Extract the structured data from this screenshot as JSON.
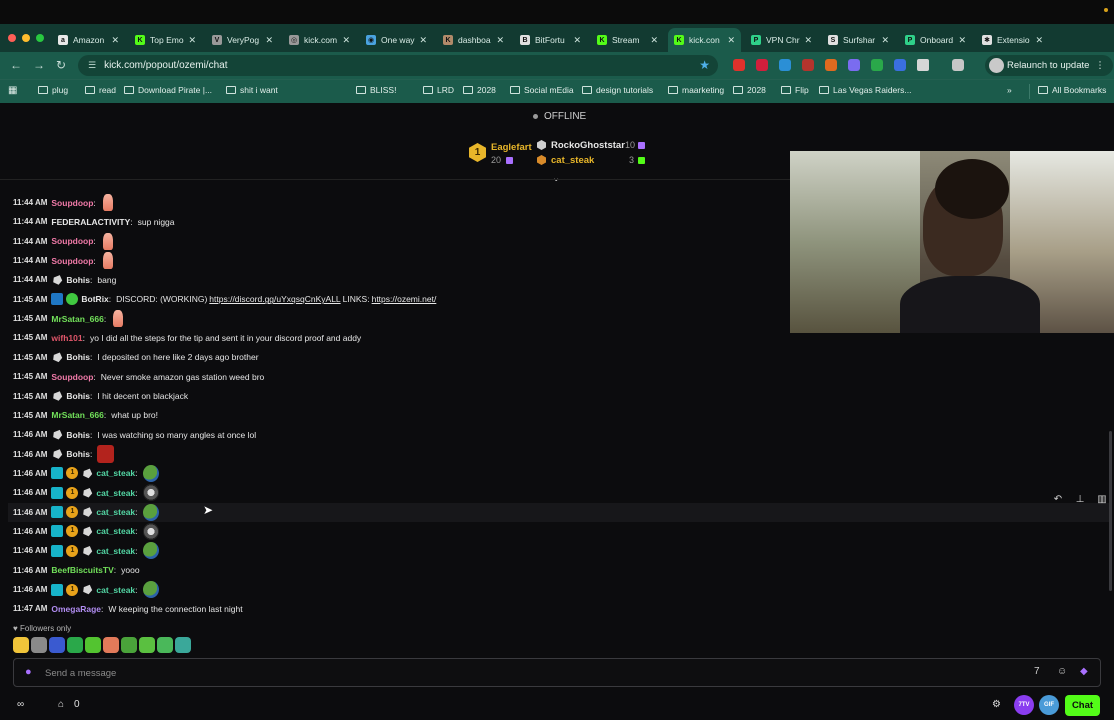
{
  "browser": {
    "tabs": [
      {
        "label": "Amazon",
        "fav": "a",
        "color": "#e8e8e8",
        "fg": "#111"
      },
      {
        "label": "Top Emo",
        "fav": "K",
        "color": "#53fc18",
        "fg": "#111"
      },
      {
        "label": "VeryPog",
        "fav": "V",
        "color": "#999",
        "fg": "#111"
      },
      {
        "label": "kick.com",
        "fav": "◎",
        "color": "#999",
        "fg": "#111"
      },
      {
        "label": "One way",
        "fav": "◉",
        "color": "#4aa3e0",
        "fg": "#111"
      },
      {
        "label": "dashboa",
        "fav": "K",
        "color": "#b18a6a",
        "fg": "#111"
      },
      {
        "label": "BitFortu",
        "fav": "B",
        "color": "#e0e0e0",
        "fg": "#111"
      },
      {
        "label": "Stream",
        "fav": "K",
        "color": "#53fc18",
        "fg": "#111"
      },
      {
        "label": "kick.con",
        "fav": "K",
        "color": "#53fc18",
        "fg": "#111"
      },
      {
        "label": "VPN Chr",
        "fav": "P",
        "color": "#2fd18a",
        "fg": "#111"
      },
      {
        "label": "Surfshar",
        "fav": "S",
        "color": "#e0e0e0",
        "fg": "#111"
      },
      {
        "label": "Onboard",
        "fav": "P",
        "color": "#2fd18a",
        "fg": "#111"
      },
      {
        "label": "Extensio",
        "fav": "✱",
        "color": "#e0e0e0",
        "fg": "#111"
      }
    ],
    "url": "kick.com/popout/ozemi/chat",
    "relaunch_label": "Relaunch to update",
    "bookmarks": [
      "plug",
      "read",
      "Download Pirate |...",
      "shit i want",
      "BLISS!",
      "LRD",
      "2028",
      "Social mEdia",
      "design tutorials",
      "maarketing",
      "2028",
      "Flip",
      "Las Vegas Raiders..."
    ],
    "all_bookmarks_label": "All Bookmarks"
  },
  "stream": {
    "status": "OFFLINE",
    "leaderboard": [
      {
        "rank": "1",
        "name": "Eaglefart",
        "count": "20"
      },
      {
        "name": "RockoGhoststar",
        "count": "10"
      },
      {
        "name": "cat_steak",
        "count": "3"
      }
    ]
  },
  "chat": {
    "messages": [
      {
        "time": "11:44 AM",
        "user": "Soupdoop",
        "user_color": "#f07aa8",
        "text": "",
        "emote": "hand"
      },
      {
        "time": "11:44 AM",
        "user": "FEDERALACTIVITY",
        "user_color": "#e6e6e6",
        "text": "sup nigga"
      },
      {
        "time": "11:44 AM",
        "user": "Soupdoop",
        "user_color": "#f07aa8",
        "text": "",
        "emote": "hand"
      },
      {
        "time": "11:44 AM",
        "user": "Soupdoop",
        "user_color": "#f07aa8",
        "text": "",
        "emote": "hand"
      },
      {
        "time": "11:44 AM",
        "user": "Bohis",
        "user_color": "#e6e6e6",
        "badges": [
          "og"
        ],
        "text": "bang"
      },
      {
        "time": "11:45 AM",
        "user": "BotRix",
        "user_color": "#e6e6e6",
        "badges": [
          "bot",
          "verified"
        ],
        "text": "DISCORD: (WORKING)",
        "link1": "https://discord.gg/uYxqsqCnKyALL",
        "text2": "LINKS:",
        "link2": "https://ozemi.net/"
      },
      {
        "time": "11:45 AM",
        "user": "MrSatan_666",
        "user_color": "#72e05a",
        "text": "",
        "emote": "hand"
      },
      {
        "time": "11:45 AM",
        "user": "wifh101",
        "user_color": "#e0566a",
        "text": "yo I did all the steps for the tip and sent it in your discord proof and addy"
      },
      {
        "time": "11:45 AM",
        "user": "Bohis",
        "user_color": "#e6e6e6",
        "badges": [
          "og"
        ],
        "text": "I deposited on here like 2 days ago brother"
      },
      {
        "time": "11:45 AM",
        "user": "Soupdoop",
        "user_color": "#f07aa8",
        "text": "Never smoke amazon gas station weed bro"
      },
      {
        "time": "11:45 AM",
        "user": "Bohis",
        "user_color": "#e6e6e6",
        "badges": [
          "og"
        ],
        "text": "I hit decent on blackjack"
      },
      {
        "time": "11:45 AM",
        "user": "MrSatan_666",
        "user_color": "#72e05a",
        "text": "what up bro!"
      },
      {
        "time": "11:46 AM",
        "user": "Bohis",
        "user_color": "#e6e6e6",
        "badges": [
          "og"
        ],
        "text": "I was watching so many angles at once lol"
      },
      {
        "time": "11:46 AM",
        "user": "Bohis",
        "user_color": "#e6e6e6",
        "badges": [
          "og"
        ],
        "text": "",
        "emote": "rage"
      },
      {
        "time": "11:46 AM",
        "user": "cat_steak",
        "user_color": "#53d6a4",
        "badges": [
          "sub",
          "vip",
          "og"
        ],
        "text": "",
        "emote": "pepe"
      },
      {
        "time": "11:46 AM",
        "user": "cat_steak",
        "user_color": "#53d6a4",
        "badges": [
          "sub",
          "vip",
          "og"
        ],
        "text": "",
        "emote": "sad"
      },
      {
        "time": "11:46 AM",
        "user": "cat_steak",
        "user_color": "#53d6a4",
        "badges": [
          "sub",
          "vip",
          "og"
        ],
        "text": "",
        "emote": "pepe",
        "highlight": true
      },
      {
        "time": "11:46 AM",
        "user": "cat_steak",
        "user_color": "#53d6a4",
        "badges": [
          "sub",
          "vip",
          "og"
        ],
        "text": "",
        "emote": "sad"
      },
      {
        "time": "11:46 AM",
        "user": "cat_steak",
        "user_color": "#53d6a4",
        "badges": [
          "sub",
          "vip",
          "og"
        ],
        "text": "",
        "emote": "pepe"
      },
      {
        "time": "11:46 AM",
        "user": "BeefBiscuitsTV",
        "user_color": "#72e05a",
        "text": "yooo"
      },
      {
        "time": "11:46 AM",
        "user": "cat_steak",
        "user_color": "#53d6a4",
        "badges": [
          "sub",
          "vip",
          "og"
        ],
        "text": "",
        "emote": "pepe"
      },
      {
        "time": "11:47 AM",
        "user": "OmegaRage",
        "user_color": "#b08cf0",
        "text": "W keeping the connection last night"
      }
    ],
    "followers_only": "Followers only",
    "input_placeholder": "Send a message",
    "chat_button": "Chat",
    "footer_count": "0",
    "pill_7tv": "7TV",
    "pill_gif": "GIF"
  }
}
